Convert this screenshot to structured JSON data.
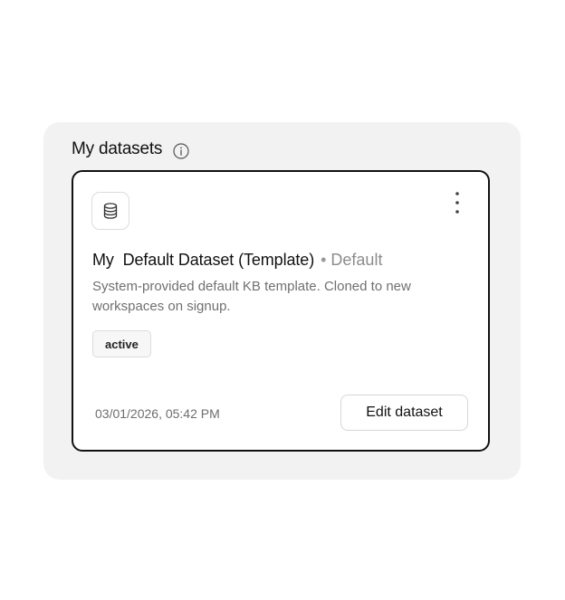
{
  "section": {
    "title": "My datasets",
    "info_icon": "info-icon"
  },
  "dataset_card": {
    "icon": "database-icon",
    "menu_icon": "more-vertical-icon",
    "title": "My  Default Dataset (Template)",
    "separator": "•",
    "default_label": "Default",
    "description": "System-provided default KB template. Cloned to new workspaces on signup.",
    "status": "active",
    "timestamp": "03/01/2026, 05:42 PM",
    "edit_label": "Edit dataset"
  }
}
